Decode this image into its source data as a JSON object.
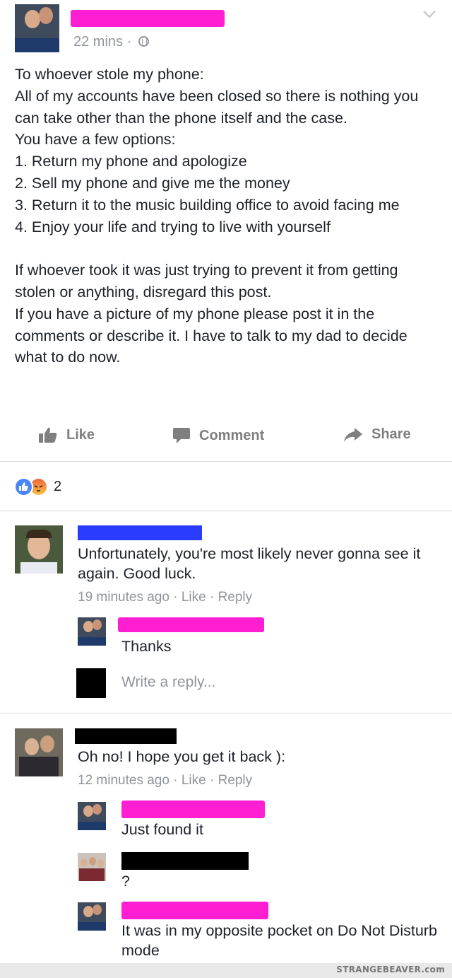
{
  "post": {
    "timestamp": "22 mins",
    "timestamp_sep": "·",
    "lines_block_1": "To whoever stole my phone:\nAll of my accounts have been closed so there is nothing you can take other than the phone itself and the case.\nYou have a few options:\n1. Return my phone and apologize\n2. Sell my phone and give me the money\n3. Return it to the music building office to avoid facing me\n4. Enjoy your life and trying to live with yourself",
    "lines_block_2": "If whoever took it was just trying to prevent it from getting stolen or anything, disregard this post.\nIf you have a picture of my phone please post it in the comments or describe it. I have to talk to my dad to decide what to do now."
  },
  "actions": {
    "like": "Like",
    "comment": "Comment",
    "share": "Share"
  },
  "reactions": {
    "count": "2",
    "types": [
      "like",
      "angry"
    ]
  },
  "comments": [
    {
      "text": "Unfortunately, you're most likely never gonna see it again. Good luck.",
      "time": "19 minutes ago",
      "like": "Like",
      "reply": "Reply",
      "sep": "·",
      "replies": [
        {
          "text": "Thanks"
        }
      ],
      "write_reply_placeholder": "Write a reply..."
    },
    {
      "text": "Oh no! I hope you get it back ):",
      "time": "12 minutes ago",
      "like": "Like",
      "reply": "Reply",
      "sep": "·",
      "replies": [
        {
          "text": "Just found it"
        },
        {
          "text": "?"
        },
        {
          "text": "It was in my opposite pocket on Do Not Disturb mode"
        }
      ]
    }
  ],
  "watermark": "STRANGEBEAVER.com",
  "icons": [
    "globe-icon",
    "chevron-down-icon",
    "like-thumb-icon",
    "comment-bubble-icon",
    "share-arrow-icon",
    "like-reaction-icon",
    "angry-reaction-icon"
  ],
  "colors": {
    "redaction_pink": "#ff1ed2",
    "redaction_blue": "#2a3cff",
    "redaction_black": "#000000",
    "meta_gray": "#90949c",
    "like_blue": "#4a86f7"
  }
}
